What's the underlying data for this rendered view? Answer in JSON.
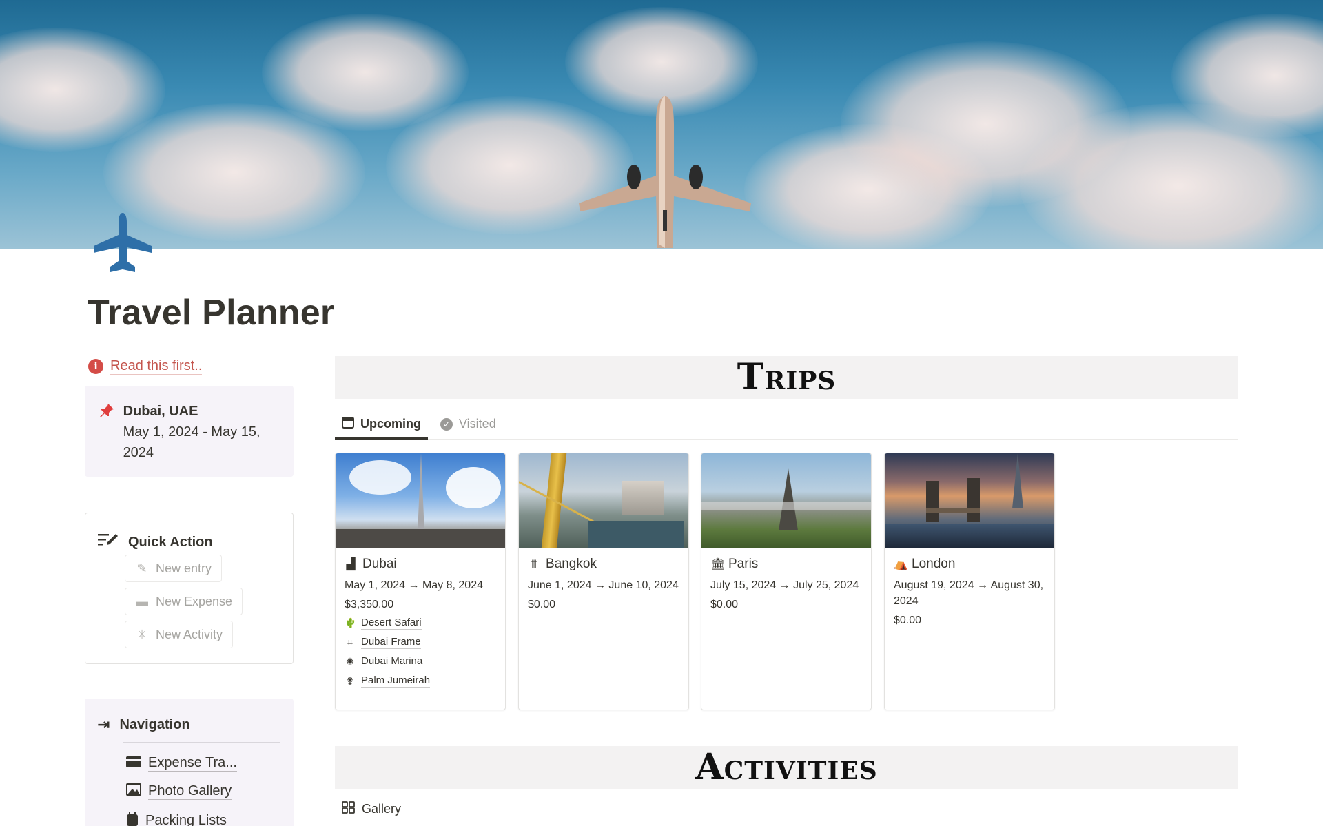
{
  "page": {
    "title": "Travel Planner"
  },
  "callout_link": {
    "label": "Read this first.."
  },
  "current_trip": {
    "destination": "Dubai, UAE",
    "dates": "May 1, 2024 - May 15, 2024"
  },
  "quick_action": {
    "title": "Quick Action",
    "buttons": [
      {
        "label": "New entry",
        "icon": "pencil-icon"
      },
      {
        "label": "New Expense",
        "icon": "credit-card-icon"
      },
      {
        "label": "New Activity",
        "icon": "asterisk-icon"
      }
    ]
  },
  "navigation": {
    "title": "Navigation",
    "items": [
      {
        "label": "Expense Tra...",
        "icon": "credit-card-icon"
      },
      {
        "label": "Photo Gallery",
        "icon": "image-icon"
      },
      {
        "label": "Packing Lists",
        "icon": "luggage-icon"
      }
    ]
  },
  "trips": {
    "heading": "Trips",
    "tabs": [
      {
        "label": "Upcoming",
        "icon": "calendar-icon",
        "active": true
      },
      {
        "label": "Visited",
        "icon": "check-circle-icon",
        "active": false
      }
    ],
    "cards": [
      {
        "name": "Dubai",
        "icon": "city-icon",
        "dates": "May 1, 2024 → May 8, 2024",
        "amount": "$3,350.00",
        "activities": [
          {
            "label": "Desert Safari",
            "icon": "cactus-icon"
          },
          {
            "label": "Dubai Frame",
            "icon": "frame-icon"
          },
          {
            "label": "Dubai Marina",
            "icon": "fireworks-icon"
          },
          {
            "label": "Palm Jumeirah",
            "icon": "palm-icon"
          }
        ]
      },
      {
        "name": "Bangkok",
        "icon": "bridge-icon",
        "dates": "June 1, 2024 → June 10, 2024",
        "amount": "$0.00",
        "activities": []
      },
      {
        "name": "Paris",
        "icon": "museum-icon",
        "dates": "July 15, 2024 → July 25, 2024",
        "amount": "$0.00",
        "activities": []
      },
      {
        "name": "London",
        "icon": "gallery-icon",
        "dates": "August 19, 2024 → August 30, 2024",
        "amount": "$0.00",
        "activities": []
      }
    ]
  },
  "activities": {
    "heading": "Activities",
    "view_tab": {
      "label": "Gallery",
      "icon": "grid-icon"
    }
  },
  "colors": {
    "link_red": "#c4554d",
    "callout_bg": "#f6f3f9",
    "banner_bg": "#f3f2f2",
    "icon_blue": "#2e6fa8"
  }
}
